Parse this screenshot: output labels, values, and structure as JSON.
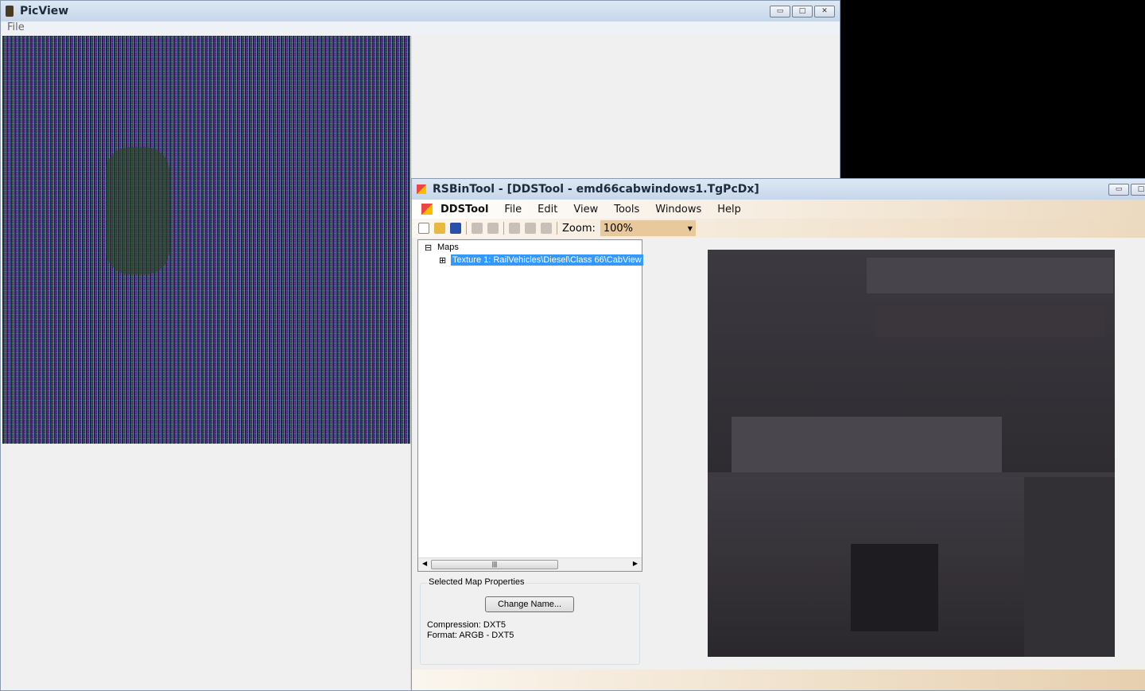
{
  "picview": {
    "title": "PicView",
    "menu": [
      "File"
    ]
  },
  "rsbintool": {
    "title": "RSBinTool - [DDSTool - emd66cabwindows1.TgPcDx]",
    "menu": [
      "DDSTool",
      "File",
      "Edit",
      "View",
      "Tools",
      "Windows",
      "Help"
    ],
    "toolbar": {
      "zoom_label": "Zoom:",
      "zoom_value": "100%"
    },
    "tree": {
      "root": "Maps",
      "child": "Texture 1: RailVehicles\\Diesel\\Class 66\\CabView"
    },
    "props": {
      "title": "Selected Map Properties",
      "change_name": "Change Name...",
      "compression": "Compression: DXT5",
      "format": "Format: ARGB - DXT5"
    }
  }
}
